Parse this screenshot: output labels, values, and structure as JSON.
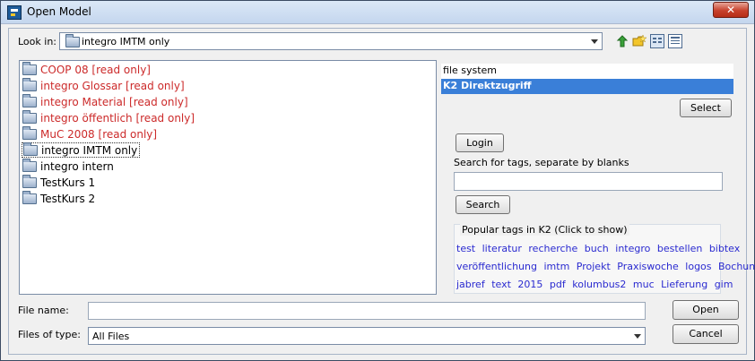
{
  "window": {
    "title": "Open Model",
    "close_label": "✕"
  },
  "lookin": {
    "label": "Look in:",
    "value": "integro IMTM only"
  },
  "folders": [
    {
      "name": "COOP 08 [read only]",
      "readonly": true
    },
    {
      "name": "integro Glossar [read only]",
      "readonly": true
    },
    {
      "name": "integro Material [read only]",
      "readonly": true
    },
    {
      "name": "integro öffentlich [read only]",
      "readonly": true
    },
    {
      "name": "MuC 2008 [read only]",
      "readonly": true
    },
    {
      "name": "integro IMTM only",
      "readonly": false,
      "selected": true
    },
    {
      "name": "integro intern",
      "readonly": false
    },
    {
      "name": "TestKurs 1",
      "readonly": false
    },
    {
      "name": "TestKurs 2",
      "readonly": false
    }
  ],
  "sources": {
    "items": [
      "file system",
      "K2 Direktzugriff"
    ],
    "selected": "K2 Direktzugriff"
  },
  "buttons": {
    "select": "Select",
    "login": "Login",
    "search": "Search",
    "open": "Open",
    "cancel": "Cancel"
  },
  "search": {
    "label": "Search for tags, separate by blanks",
    "value": ""
  },
  "popular": {
    "title": "Popular tags in K2 (Click to show)",
    "lines": [
      [
        "test",
        "literatur",
        "recherche",
        "buch",
        "integro",
        "bestellen",
        "bibtex"
      ],
      [
        "veröffentlichung",
        "imtm",
        "Projekt",
        "Praxiswoche",
        "logos",
        "Bochum"
      ],
      [
        "jabref",
        "text",
        "2015",
        "pdf",
        "kolumbus2",
        "muc",
        "Lieferung",
        "gim"
      ]
    ]
  },
  "filename": {
    "label": "File name:",
    "value": ""
  },
  "filetype": {
    "label": "Files of type:",
    "value": "All Files"
  },
  "colors": {
    "readonly_text": "#cc2a2a",
    "selection": "#3a7fd8",
    "tag_link": "#2a2ad0"
  },
  "icons": [
    "app-icon",
    "up-folder-icon",
    "new-folder-icon",
    "list-view-icon",
    "details-view-icon",
    "folder-icon",
    "chevron-down-icon",
    "close-icon"
  ]
}
